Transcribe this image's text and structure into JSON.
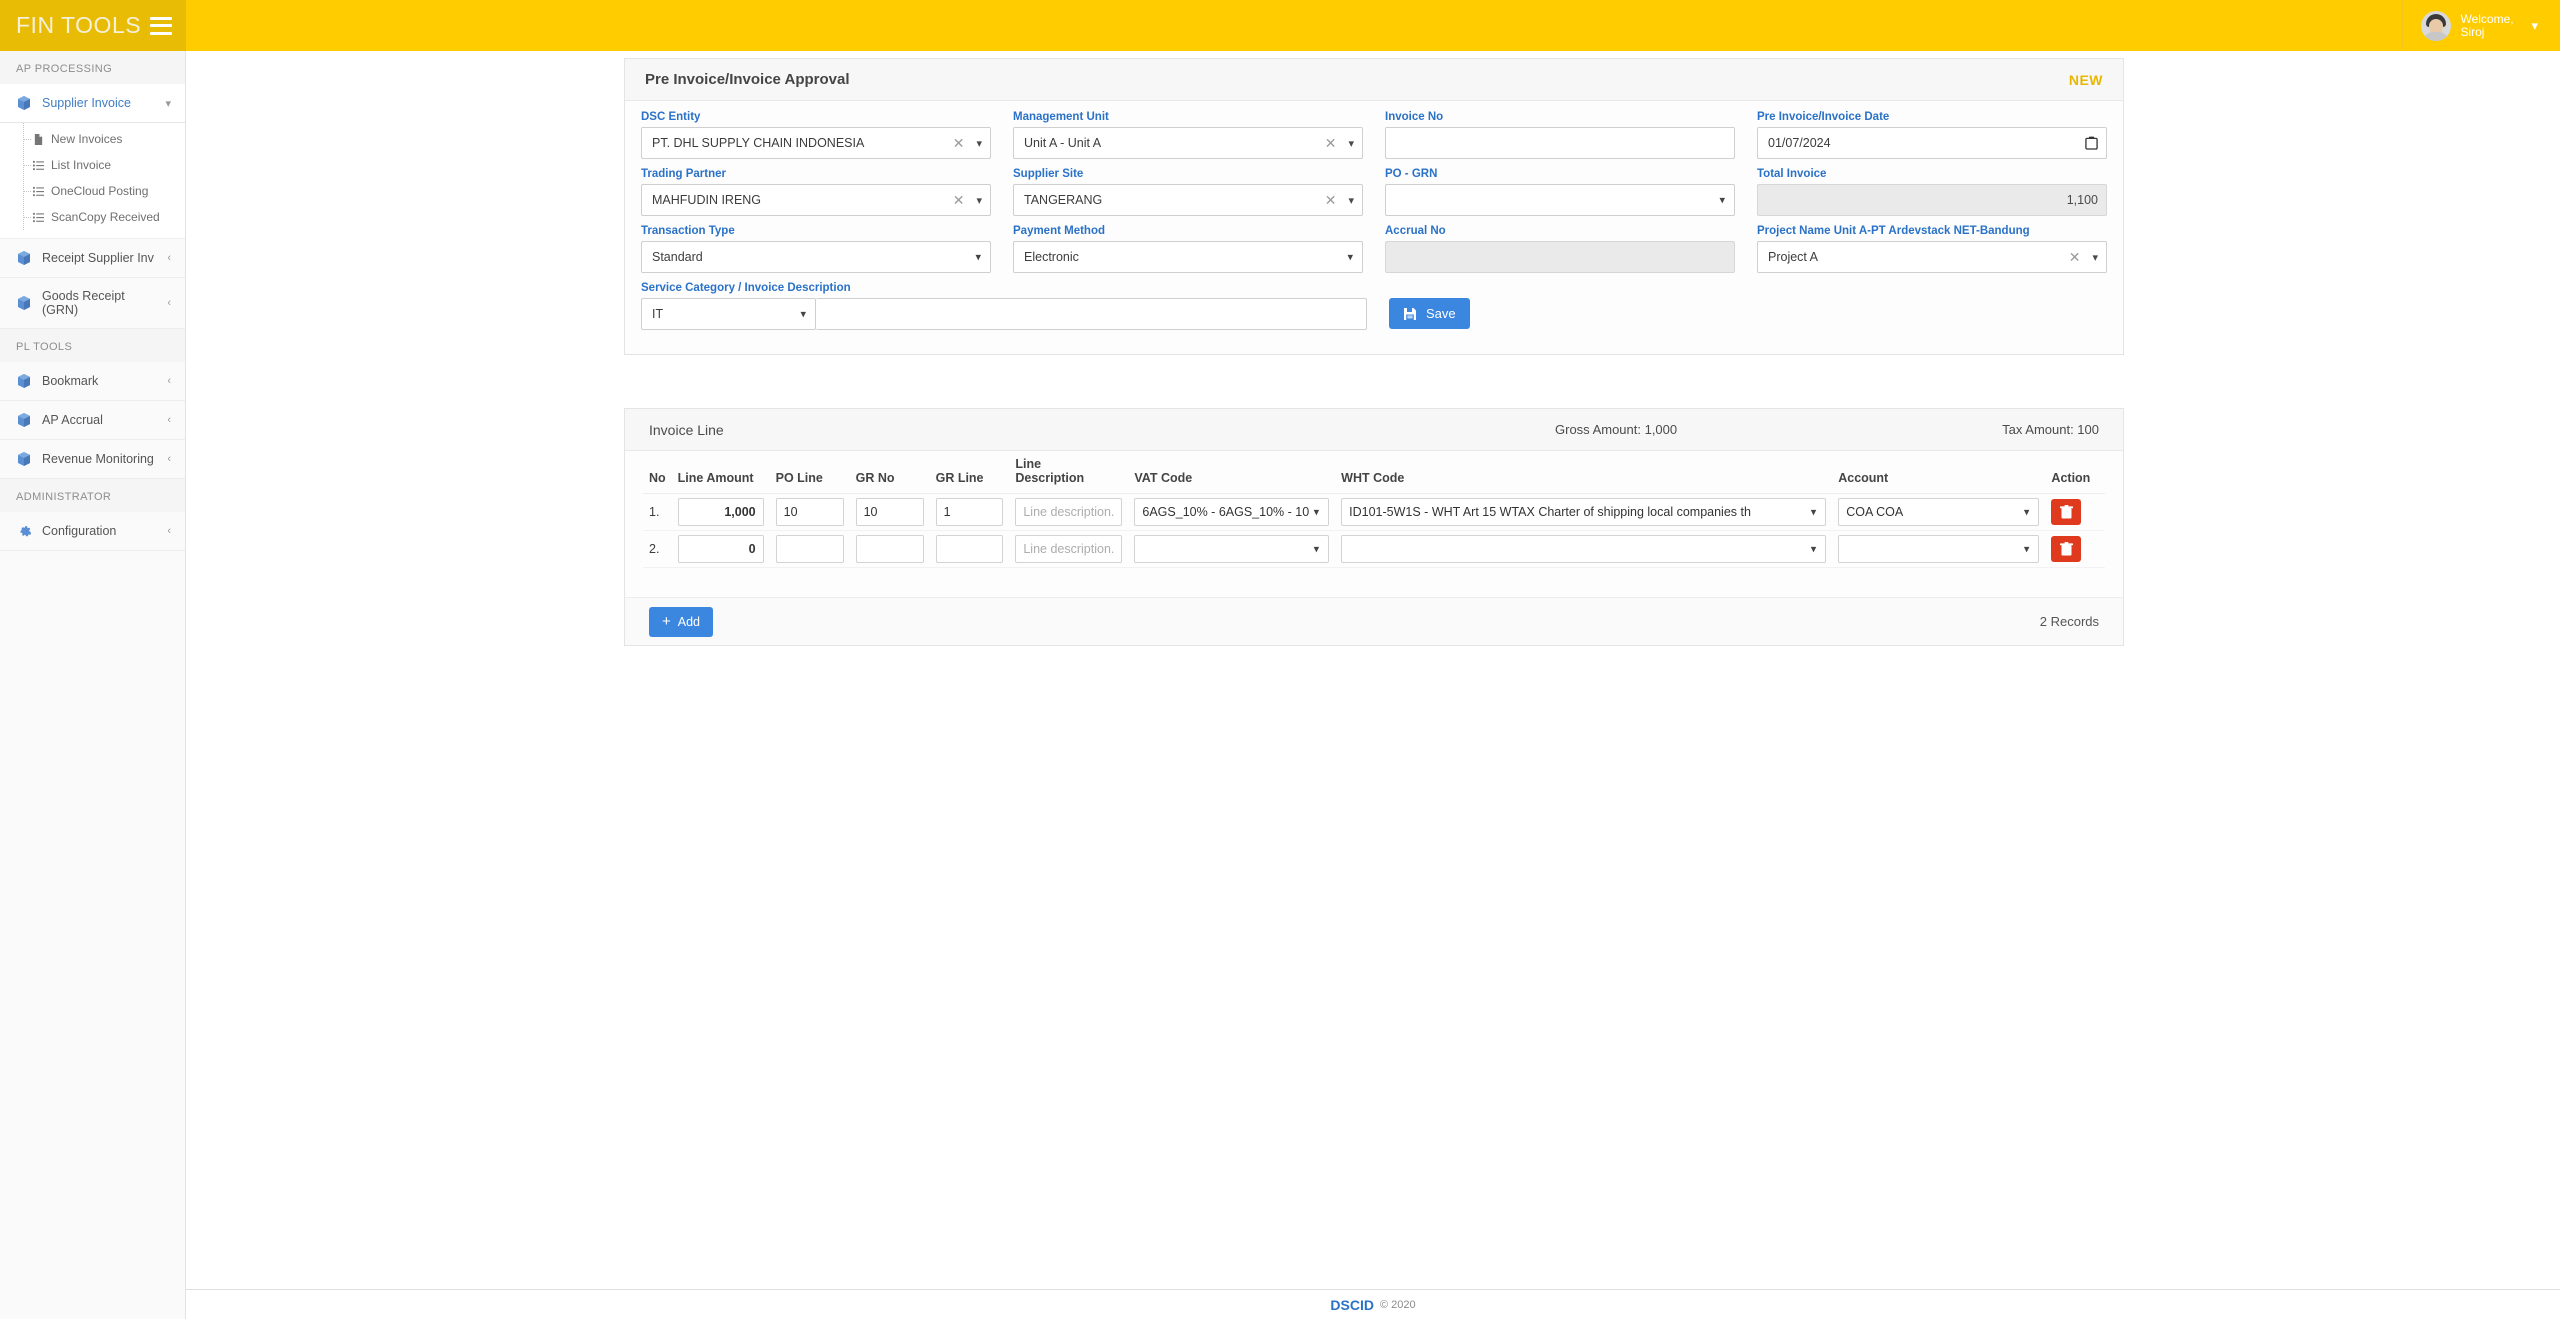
{
  "topbar": {
    "brand": "FIN TOOLS",
    "menu_icon": "hamburger-icon",
    "welcome": "Welcome, Siroj"
  },
  "sidebar": {
    "sections": [
      {
        "label": "AP PROCESSING"
      },
      {
        "label": "PL TOOLS"
      },
      {
        "label": "ADMINISTRATOR"
      }
    ],
    "supplier_invoice": "Supplier Invoice",
    "sub_items": [
      {
        "label": "New Invoices",
        "icon": "file-icon"
      },
      {
        "label": "List Invoice",
        "icon": "list-icon"
      },
      {
        "label": "OneCloud Posting",
        "icon": "list-icon"
      },
      {
        "label": "ScanCopy Received",
        "icon": "list-icon"
      }
    ],
    "items": [
      {
        "label": "Receipt Supplier Inv",
        "icon": "cube-icon"
      },
      {
        "label": "Goods Receipt (GRN)",
        "icon": "cube-icon"
      },
      {
        "label": "Bookmark",
        "icon": "cube-icon"
      },
      {
        "label": "AP Accrual",
        "icon": "cube-icon"
      },
      {
        "label": "Revenue Monitoring",
        "icon": "cube-icon"
      },
      {
        "label": "Configuration",
        "icon": "gear-icon"
      }
    ]
  },
  "form": {
    "title": "Pre Invoice/Invoice Approval",
    "status_badge": "NEW",
    "dsc_entity": {
      "label": "DSC Entity",
      "value": "PT. DHL SUPPLY CHAIN INDONESIA"
    },
    "management_unit": {
      "label": "Management Unit",
      "value": "Unit A - Unit A"
    },
    "invoice_no": {
      "label": "Invoice No",
      "value": ""
    },
    "invoice_date": {
      "label": "Pre Invoice/Invoice Date",
      "value": "01/07/2024"
    },
    "trading_partner": {
      "label": "Trading Partner",
      "value": "MAHFUDIN IRENG"
    },
    "supplier_site": {
      "label": "Supplier Site",
      "value": "TANGERANG"
    },
    "po_grn": {
      "label": "PO - GRN",
      "value": ""
    },
    "total_invoice": {
      "label": "Total Invoice",
      "value": "1,100"
    },
    "transaction_type": {
      "label": "Transaction Type",
      "value": "Standard"
    },
    "payment_method": {
      "label": "Payment Method",
      "value": "Electronic"
    },
    "accrual_no": {
      "label": "Accrual No",
      "value": ""
    },
    "project_name": {
      "label": "Project Name Unit A-PT Ardevstack NET-Bandung",
      "value": "Project A"
    },
    "service_category": {
      "label": "Service Category / Invoice Description",
      "value": "IT",
      "description": ""
    },
    "save_label": "Save"
  },
  "line_section": {
    "title": "Invoice Line",
    "gross_amount": "Gross Amount: 1,000",
    "tax_amount": "Tax Amount: 100",
    "columns": [
      "No",
      "Line Amount",
      "PO Line",
      "GR No",
      "GR Line",
      "Line Description",
      "VAT Code",
      "WHT Code",
      "Account",
      "Action"
    ],
    "line_description_placeholder": "Line description.",
    "rows": [
      {
        "no": "1.",
        "line_amount": "1,000",
        "po_line": "10",
        "gr_no": "10",
        "gr_line": "1",
        "line_description": "",
        "vat_code": "6AGS_10% - 6AGS_10% - 10",
        "wht_code": "ID101-5W1S - WHT Art 15 WTAX Charter of shipping local companies th",
        "account": "COA COA"
      },
      {
        "no": "2.",
        "line_amount": "0",
        "po_line": "",
        "gr_no": "",
        "gr_line": "",
        "line_description": "",
        "vat_code": "",
        "wht_code": "",
        "account": ""
      }
    ],
    "add_label": "Add",
    "records": "2 Records"
  },
  "footer": {
    "brand": "DSCID",
    "copyright": "© 2020"
  },
  "colors": {
    "brand_yellow": "#ffcc00",
    "accent_blue": "#2a72c7",
    "button_blue": "#3b87e0",
    "danger_red": "#e03a1e",
    "badge_yellow": "#e8b700"
  }
}
